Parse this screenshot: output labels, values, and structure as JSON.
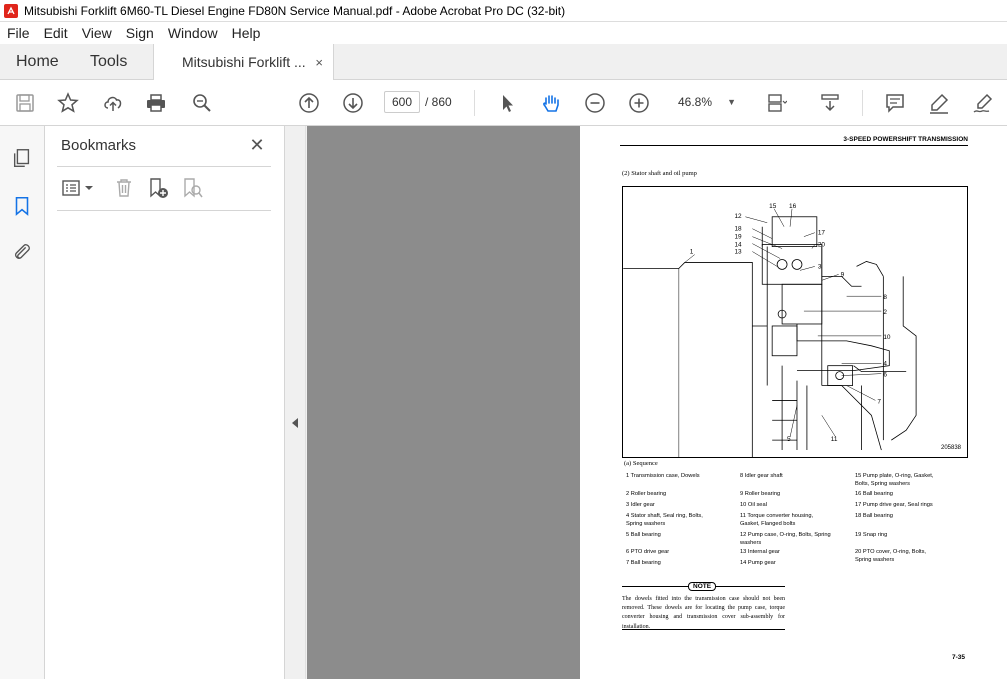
{
  "window": {
    "title": "Mitsubishi Forklift 6M60-TL Diesel Engine FD80N Service Manual.pdf - Adobe Acrobat Pro DC (32-bit)"
  },
  "menu": [
    "File",
    "Edit",
    "View",
    "Sign",
    "Window",
    "Help"
  ],
  "tabs": {
    "home": "Home",
    "tools": "Tools",
    "document": "Mitsubishi Forklift ...",
    "close_symbol": "×"
  },
  "toolbar": {
    "current_page": "600",
    "total_pages": "/ 860",
    "zoom": "46.8%",
    "zoom_chevron": "▼"
  },
  "bookmarks": {
    "title": "Bookmarks",
    "close_symbol": "✕"
  },
  "pdf": {
    "header": "3-SPEED POWERSHIFT TRANSMISSION",
    "subtitle": "(2)  Stator shaft and oil pump",
    "diagram_code": "205838",
    "diagram_labels": [
      "1",
      "2",
      "3",
      "4",
      "5",
      "6",
      "7",
      "8",
      "9",
      "10",
      "11",
      "12",
      "13",
      "14",
      "15",
      "16",
      "17",
      "18",
      "19",
      "20"
    ],
    "sequence_title": "(a)  Sequence",
    "sequence": [
      "1  Transmission case, Dowels",
      "2  Roller bearing",
      "3  Idler gear",
      "4  Stator shaft, Seal ring, Bolts,\n    Spring washers",
      "5  Ball bearing",
      "6  PTO drive gear",
      "7  Ball bearing",
      "8  Idler gear shaft",
      "9  Roller bearing",
      "10 Oil seal",
      "11 Torque converter housing,\n    Gasket, Flanged bolts",
      "12 Pump case, O-ring, Bolts, Spring\n    washers",
      "13 Internal gear",
      "14 Pump gear",
      "15 Pump plate, O-ring, Gasket,\n    Bolts, Spring washers",
      "16 Ball bearing",
      "17 Pump drive gear, Seal rings",
      "18 Ball bearing",
      "19 Snap ring",
      "20 PTO cover, O-ring, Bolts,\n    Spring washers"
    ],
    "note_label": "NOTE",
    "note_text": "The dowels fitted into the transmission case should not been removed. These dowels are for locating the pump case, torque converter housing and transmission cover sub-assembly for installation.",
    "page_number": "7-35"
  },
  "icons": {
    "file": "adobe-acrobat-icon",
    "save": "save-icon",
    "bookmark": "star-icon",
    "upload": "cloud-upload-icon",
    "print": "print-icon",
    "search": "search-zoom-icon",
    "prev": "page-up-icon",
    "next": "page-down-icon",
    "select": "select-arrow-icon",
    "hand": "hand-icon",
    "zoom_out": "zoom-out-icon",
    "zoom_in": "zoom-in-icon",
    "page_display": "page-display-icon",
    "scroll": "scroll-mode-icon",
    "comment": "comment-icon",
    "highlight": "highlight-icon",
    "sign": "sign-icon"
  }
}
